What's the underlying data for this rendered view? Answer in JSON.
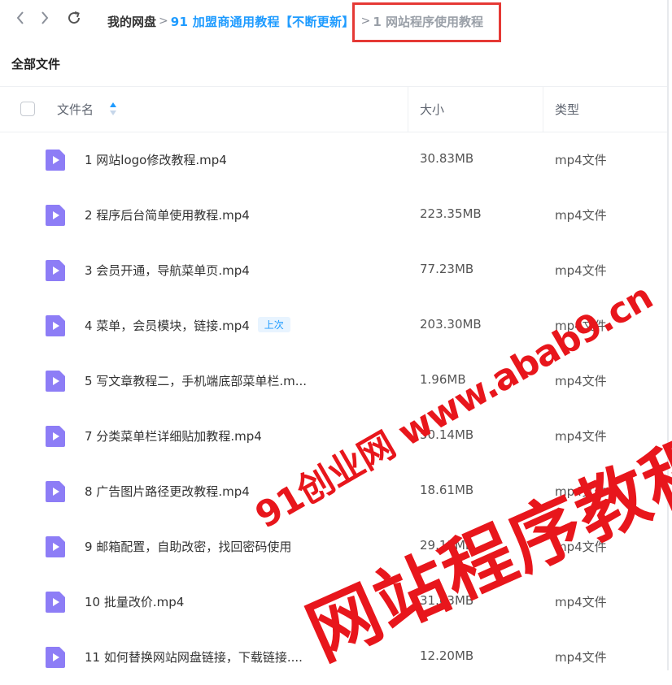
{
  "nav": {
    "back_icon": "chevron-left-icon",
    "forward_icon": "chevron-right-icon",
    "refresh_icon": "refresh-icon"
  },
  "breadcrumb": {
    "root": "我的网盘",
    "sep": ">",
    "middle": "91 加盟商通用教程【不断更新】",
    "current": "1 网站程序使用教程"
  },
  "section_title": "全部文件",
  "columns": {
    "name": "文件名",
    "size": "大小",
    "type": "类型"
  },
  "files": [
    {
      "name": "1 网站logo修改教程.mp4",
      "size": "30.83MB",
      "type": "mp4文件",
      "badge": ""
    },
    {
      "name": "2 程序后台简单使用教程.mp4",
      "size": "223.35MB",
      "type": "mp4文件",
      "badge": ""
    },
    {
      "name": "3 会员开通，导航菜单页.mp4",
      "size": "77.23MB",
      "type": "mp4文件",
      "badge": ""
    },
    {
      "name": "4 菜单，会员模块，链接.mp4",
      "size": "203.30MB",
      "type": "mp4文件",
      "badge": "上次"
    },
    {
      "name": "5 写文章教程二，手机端底部菜单栏.m...",
      "size": "1.96MB",
      "type": "mp4文件",
      "badge": ""
    },
    {
      "name": "7 分类菜单栏详细贴加教程.mp4",
      "size": "50.14MB",
      "type": "mp4文件",
      "badge": ""
    },
    {
      "name": "8 广告图片路径更改教程.mp4",
      "size": "18.61MB",
      "type": "mp4文件",
      "badge": ""
    },
    {
      "name": "9 邮箱配置，自助改密，找回密码使用",
      "size": "29.13MB",
      "type": "mp4文件",
      "badge": ""
    },
    {
      "name": "10 批量改价.mp4",
      "size": "31.63MB",
      "type": "mp4文件",
      "badge": ""
    },
    {
      "name": "11 如何替换网站网盘链接，下载链接....",
      "size": "12.20MB",
      "type": "mp4文件",
      "badge": ""
    }
  ],
  "watermark": {
    "line1": "91创业网 www.abab9.cn",
    "line2": "网站程序教程"
  },
  "colors": {
    "accent": "#1e9bff",
    "file_icon": "#8d7df6",
    "watermark": "#e8161c",
    "highlight": "#e53935"
  }
}
